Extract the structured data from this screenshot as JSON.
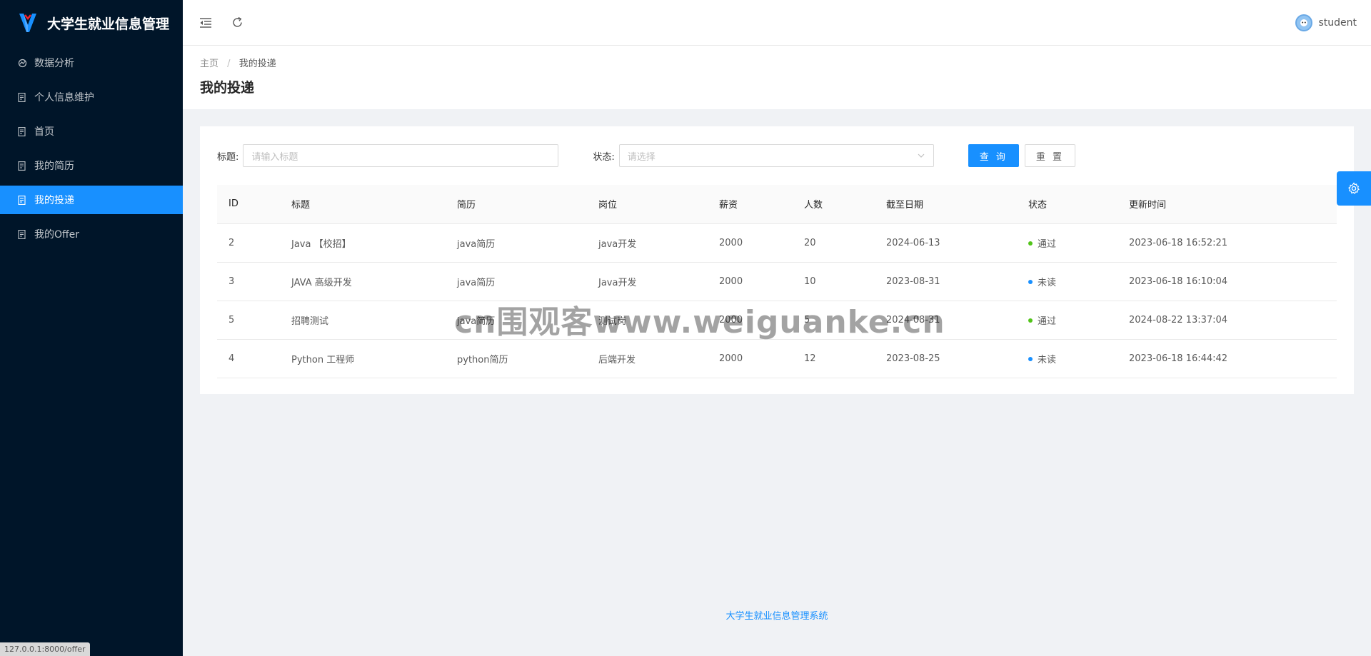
{
  "app": {
    "title": "大学生就业信息管理",
    "footer": "大学生就业信息管理系统",
    "status_url": "127.0.0.1:8000/offer"
  },
  "colors": {
    "sider_bg": "#001529",
    "primary": "#1890ff",
    "pass": "#52c41a",
    "unread": "#1890ff"
  },
  "sidebar": {
    "items": [
      {
        "label": "数据分析",
        "icon": "analytics-icon",
        "active": false
      },
      {
        "label": "个人信息维护",
        "icon": "document-icon",
        "active": false
      },
      {
        "label": "首页",
        "icon": "document-icon",
        "active": false
      },
      {
        "label": "我的简历",
        "icon": "document-icon",
        "active": false
      },
      {
        "label": "我的投递",
        "icon": "document-icon",
        "active": true
      },
      {
        "label": "我的Offer",
        "icon": "document-icon",
        "active": false
      }
    ]
  },
  "header": {
    "username": "student",
    "icons": [
      "menu-fold-icon",
      "reload-icon"
    ]
  },
  "breadcrumb": {
    "home": "主页",
    "separator": "/",
    "current": "我的投递"
  },
  "page": {
    "title": "我的投递"
  },
  "filters": {
    "title_label": "标题:",
    "title_placeholder": "请输入标题",
    "status_label": "状态:",
    "status_placeholder": "请选择",
    "search_button": "查 询",
    "reset_button": "重 置"
  },
  "table": {
    "columns": [
      "ID",
      "标题",
      "简历",
      "岗位",
      "薪资",
      "人数",
      "截至日期",
      "状态",
      "更新时间"
    ],
    "rows": [
      {
        "id": "2",
        "title": "Java 【校招】",
        "resume": "java简历",
        "job": "java开发",
        "salary": "2000",
        "count": "20",
        "deadline": "2024-06-13",
        "status": "通过",
        "status_color": "#52c41a",
        "updated": "2023-06-18 16:52:21"
      },
      {
        "id": "3",
        "title": "JAVA 高级开发",
        "resume": "java简历",
        "job": "Java开发",
        "salary": "2000",
        "count": "10",
        "deadline": "2023-08-31",
        "status": "未读",
        "status_color": "#1890ff",
        "updated": "2023-06-18 16:10:04"
      },
      {
        "id": "5",
        "title": "招聘测试",
        "resume": "java简历",
        "job": "测试岗",
        "salary": "2000",
        "count": "5",
        "deadline": "2024-08-31",
        "status": "通过",
        "status_color": "#52c41a",
        "updated": "2024-08-22 13:37:04"
      },
      {
        "id": "4",
        "title": "Python 工程师",
        "resume": "python简历",
        "job": "后端开发",
        "salary": "2000",
        "count": "12",
        "deadline": "2023-08-25",
        "status": "未读",
        "status_color": "#1890ff",
        "updated": "2023-06-18 16:44:42"
      }
    ]
  },
  "watermark": "cn围观客www.weiguanke.cn"
}
